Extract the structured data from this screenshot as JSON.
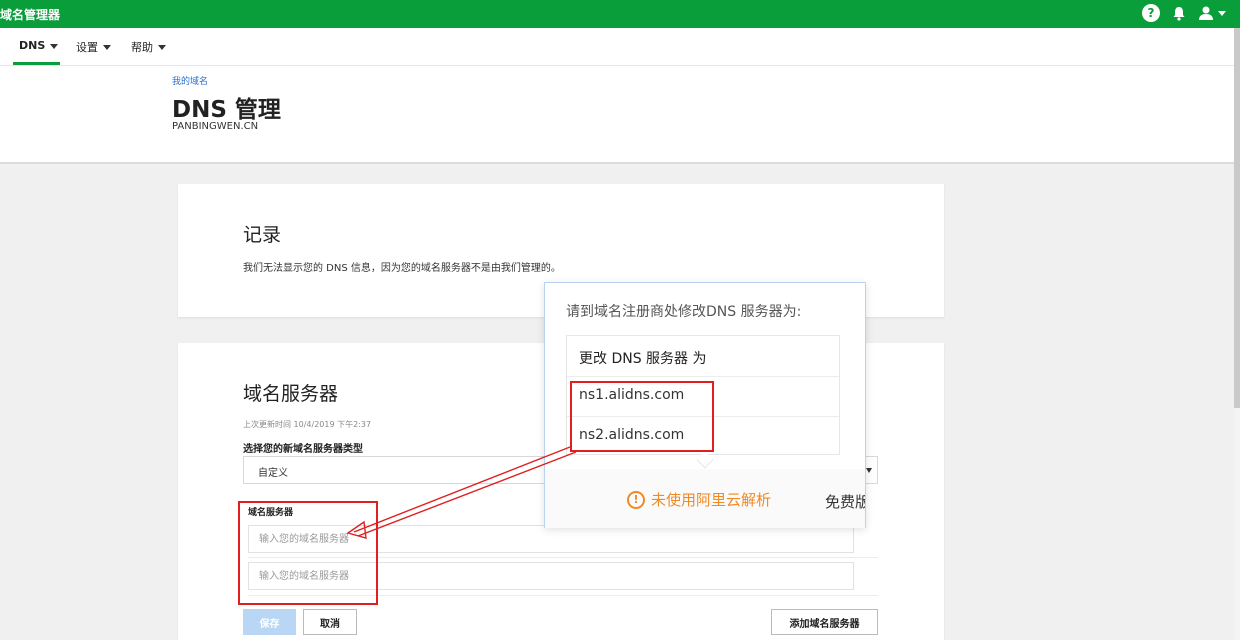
{
  "app": {
    "title": "域名管理器"
  },
  "topbar": {
    "icons": [
      "help-icon",
      "bell-icon",
      "user-icon"
    ],
    "help_glyph": "?"
  },
  "nav": {
    "items": [
      {
        "label": "DNS",
        "active": true
      },
      {
        "label": "设置",
        "active": false
      },
      {
        "label": "帮助",
        "active": false
      }
    ]
  },
  "header": {
    "breadcrumb": "我的域名",
    "title": "DNS 管理",
    "domain": "PANBINGWEN.CN"
  },
  "records": {
    "title": "记录",
    "description": "我们无法显示您的 DNS 信息，因为您的域名服务器不是由我们管理的。"
  },
  "nameservers": {
    "title": "域名服务器",
    "last_updated": "上次更新时间 10/4/2019 下午2:37",
    "type_label": "选择您的新域名服务器类型",
    "type_value": "自定义",
    "field_label": "域名服务器",
    "input_placeholder": "输入您的域名服务器",
    "save_label": "保存",
    "cancel_label": "取消",
    "add_label": "添加域名服务器"
  },
  "popup": {
    "heading": "请到域名注册商处修改DNS 服务器为:",
    "table_header": "更改 DNS 服务器 为",
    "servers": [
      "ns1.alidns.com",
      "ns2.alidns.com"
    ],
    "warning": "未使用阿里云解析",
    "free_text": "免费版"
  },
  "colors": {
    "brand_green": "#0a9e3b",
    "link_blue": "#2a6fd1",
    "warning_orange": "#f08a24",
    "annotation_red": "#e02020"
  }
}
